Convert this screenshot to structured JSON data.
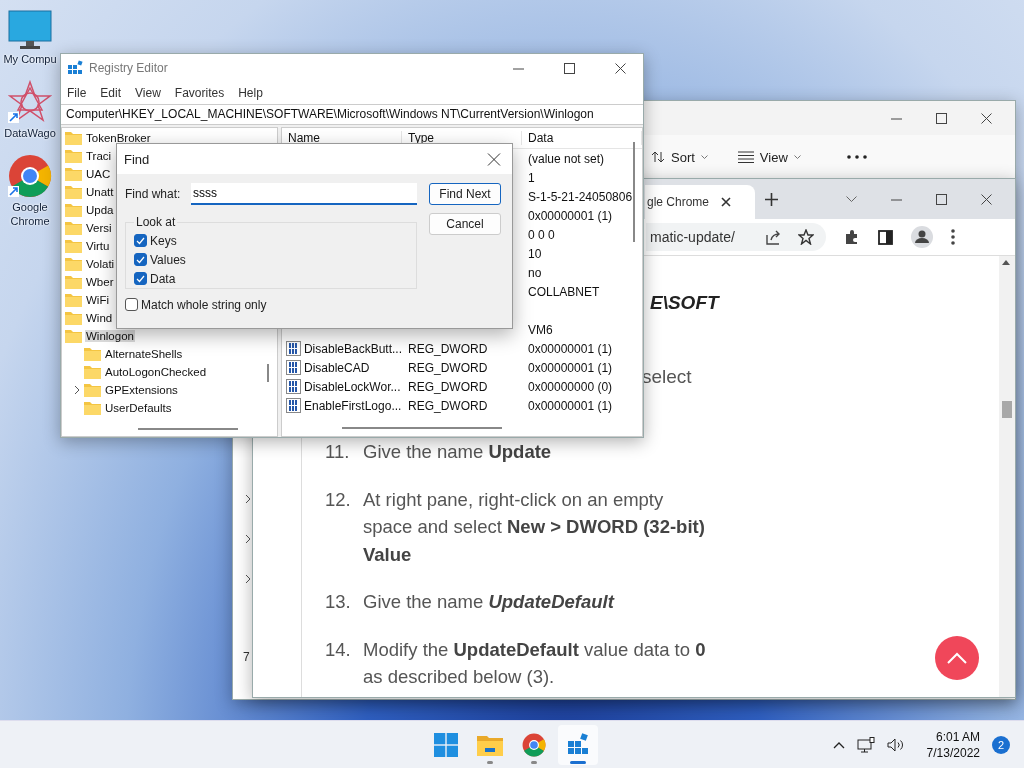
{
  "desktop_icons": [
    {
      "kind": "computer",
      "label": "My Compu",
      "shortcut": false
    },
    {
      "kind": "star",
      "label": "DataWago",
      "shortcut": true
    },
    {
      "kind": "chrome",
      "label": "Google Chrome",
      "shortcut": true
    }
  ],
  "explorer_window": {
    "toolbar": [
      {
        "kind": "sort",
        "label": "Sort"
      },
      {
        "kind": "view",
        "label": "View"
      },
      {
        "kind": "more"
      }
    ],
    "pane_text": "7"
  },
  "chrome_window": {
    "tab": {
      "title": "gle Chrome"
    },
    "address": "matic-update/",
    "page": {
      "fragments": [
        {
          "kind": "heading",
          "text": "E\\SOFT"
        },
        {
          "kind": "line",
          "text": "select"
        }
      ],
      "steps": [
        {
          "number": "11.",
          "text": "Give the name **Update**"
        },
        {
          "number": "12.",
          "text": "At right pane, right-click on an empty space and select **New > DWORD (32-bit) Value**"
        },
        {
          "number": "13.",
          "text": "Give the name *UpdateDefault*"
        },
        {
          "number": "14.",
          "text": "Modify the **UpdateDefault** value data to **0** as described below (3)."
        }
      ]
    }
  },
  "registry_editor": {
    "title": "Registry Editor",
    "menu": [
      "File",
      "Edit",
      "View",
      "Favorites",
      "Help"
    ],
    "address": "Computer\\HKEY_LOCAL_MACHINE\\SOFTWARE\\Microsoft\\Windows NT\\CurrentVersion\\Winlogon",
    "tree": [
      {
        "label": "TokenBroker",
        "selected": false
      },
      {
        "label": "Traci",
        "selected": false
      },
      {
        "label": "UAC",
        "selected": false
      },
      {
        "label": "Unatt",
        "selected": false
      },
      {
        "label": "Upda",
        "selected": false
      },
      {
        "label": "Versi",
        "selected": false
      },
      {
        "label": "Virtu",
        "selected": false
      },
      {
        "label": "Volati",
        "selected": false
      },
      {
        "label": "Wber",
        "selected": false
      },
      {
        "label": "WiFi",
        "selected": false
      },
      {
        "label": "Wind",
        "selected": false
      },
      {
        "label": "Winlogon",
        "selected": true,
        "children": [
          {
            "label": "AlternateShells",
            "selected": false,
            "expandable": false
          },
          {
            "label": "AutoLogonChecked",
            "selected": false,
            "expandable": false
          },
          {
            "label": "GPExtensions",
            "selected": false,
            "expandable": true
          },
          {
            "label": "UserDefaults",
            "selected": false,
            "expandable": false
          }
        ]
      }
    ],
    "columns": [
      "Name",
      "Type",
      "Data"
    ],
    "rows": [
      {
        "data": "(value not set)"
      },
      {
        "data": "1"
      },
      {
        "data": "S-1-5-21-24050806"
      },
      {
        "data": "0x00000001 (1)"
      },
      {
        "data": "0 0 0"
      },
      {
        "data": "10"
      },
      {
        "data": "no"
      },
      {
        "data": "COLLABNET"
      },
      {},
      {
        "data": "VM6"
      },
      {
        "kind": "dword",
        "name": "DisableBackButt...",
        "type": "REG_DWORD",
        "data": "0x00000001 (1)"
      },
      {
        "kind": "dword",
        "name": "DisableCAD",
        "type": "REG_DWORD",
        "data": "0x00000001 (1)"
      },
      {
        "kind": "dword",
        "name": "DisableLockWor...",
        "type": "REG_DWORD",
        "data": "0x00000000 (0)"
      },
      {
        "kind": "dword",
        "name": "EnableFirstLogo...",
        "type": "REG_DWORD",
        "data": "0x00000001 (1)"
      }
    ]
  },
  "find_dialog": {
    "title": "Find",
    "find_what_label": "Find what:",
    "find_what_value": "ssss",
    "look_at_label": "Look at",
    "options": [
      {
        "label": "Keys",
        "checked": true
      },
      {
        "label": "Values",
        "checked": true
      },
      {
        "label": "Data",
        "checked": true
      }
    ],
    "match_whole": {
      "label": "Match whole string only",
      "checked": false
    },
    "buttons": [
      {
        "label": "Find Next",
        "default": true
      },
      {
        "label": "Cancel",
        "default": false
      }
    ]
  },
  "taskbar": {
    "apps": [
      {
        "kind": "start",
        "running": false,
        "active": false
      },
      {
        "kind": "explorer",
        "running": true,
        "active": false
      },
      {
        "kind": "chrome",
        "running": true,
        "active": false
      },
      {
        "kind": "regedit",
        "running": true,
        "active": true
      }
    ],
    "time": "6:01 AM",
    "date": "7/13/2022",
    "notification_count": "2"
  }
}
